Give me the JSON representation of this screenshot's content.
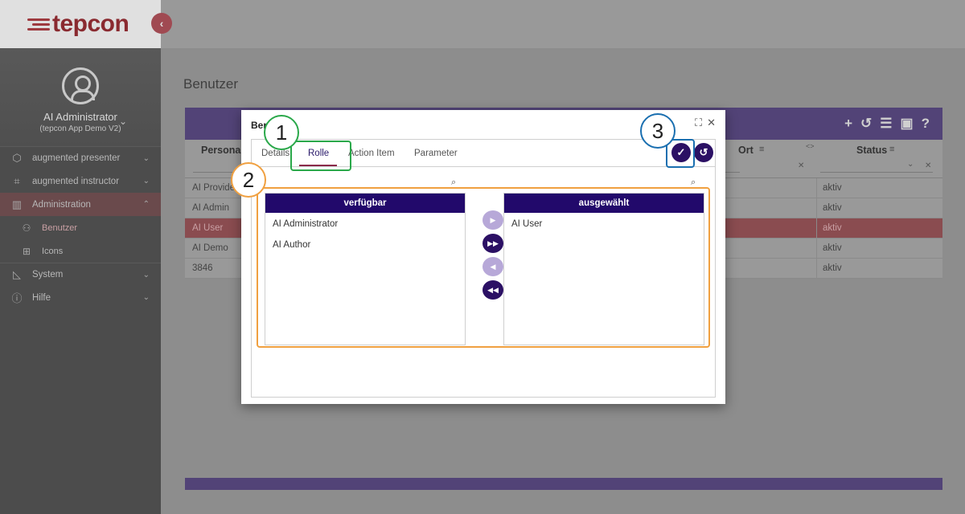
{
  "app": {
    "logo_text": "tepcon",
    "collapse_glyph": "‹"
  },
  "profile": {
    "name": "AI Administrator",
    "subtitle": "(tepcon App Demo V2)"
  },
  "sidebar": {
    "items": [
      {
        "label": "augmented presenter",
        "icon": "cube-icon"
      },
      {
        "label": "augmented instructor",
        "icon": "crop-icon"
      },
      {
        "label": "Administration",
        "icon": "library-icon"
      },
      {
        "label": "Benutzer",
        "icon": "users-icon"
      },
      {
        "label": "Icons",
        "icon": "icons-grid-icon"
      },
      {
        "label": "System",
        "icon": "ruler-icon"
      },
      {
        "label": "Hilfe",
        "icon": "help-circle-icon"
      }
    ]
  },
  "main": {
    "page_title": "Benutzer",
    "columns": {
      "personal": "Personal",
      "ort": "Ort",
      "status": "Status"
    },
    "rows": [
      {
        "name": "AI Provide",
        "status": "aktiv"
      },
      {
        "name": "AI Admin",
        "status": "aktiv"
      },
      {
        "name": "AI User",
        "status": "aktiv"
      },
      {
        "name": "AI Demo",
        "status": "aktiv"
      },
      {
        "name": "3846",
        "status": "aktiv"
      }
    ]
  },
  "modal": {
    "title": "Ben",
    "tabs": [
      "Details",
      "Rolle",
      "Action Item",
      "Parameter"
    ],
    "active_tab": "Rolle",
    "available": {
      "header": "verfügbar",
      "items": [
        "AI Administrator",
        "AI Author"
      ]
    },
    "selected": {
      "header": "ausgewählt",
      "items": [
        "AI User"
      ]
    }
  },
  "annotations": [
    "1",
    "2",
    "3"
  ],
  "colors": {
    "brand": "#8a2a30",
    "primary": "#22096b",
    "header_purple": "#524377",
    "annotation_green": "#2aa84a",
    "annotation_orange": "#f0a040",
    "annotation_blue": "#1a6fb0"
  }
}
